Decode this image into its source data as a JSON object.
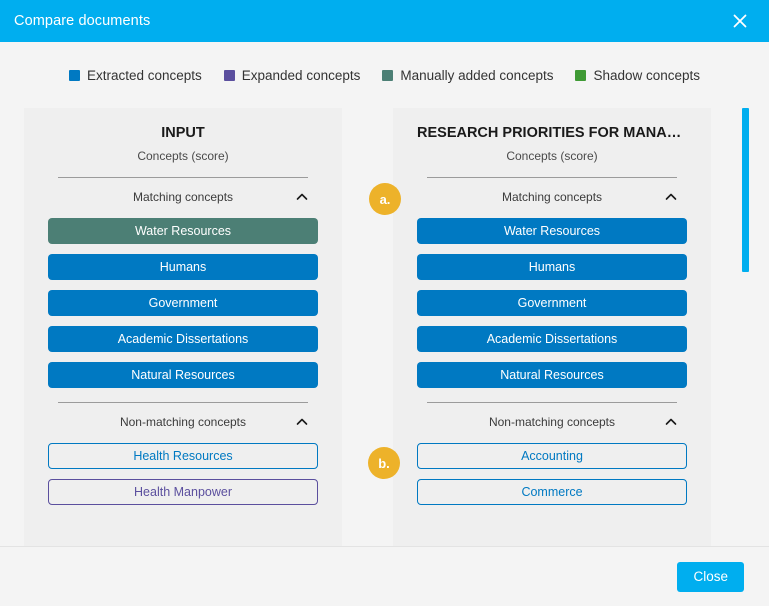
{
  "window": {
    "title": "Compare documents",
    "close_icon": "close-icon"
  },
  "legend": {
    "items": [
      {
        "label": "Extracted concepts",
        "color": "#0079C2"
      },
      {
        "label": "Expanded concepts",
        "color": "#5B4F9E"
      },
      {
        "label": "Manually added concepts",
        "color": "#4C7F75"
      },
      {
        "label": "Shadow concepts",
        "color": "#3F9A35"
      }
    ]
  },
  "panels": [
    {
      "title": "INPUT",
      "subtitle": "Concepts (score)",
      "sections": [
        {
          "header": "Matching concepts",
          "chevron": "chevron-up-icon",
          "chips": [
            {
              "label": "Water Resources",
              "style": "filled",
              "color": "#4C7F75"
            },
            {
              "label": "Humans",
              "style": "filled",
              "color": "#0079C2"
            },
            {
              "label": "Government",
              "style": "filled",
              "color": "#0079C2"
            },
            {
              "label": "Academic Dissertations",
              "style": "filled",
              "color": "#0079C2"
            },
            {
              "label": "Natural Resources",
              "style": "filled",
              "color": "#0079C2"
            }
          ]
        },
        {
          "header": "Non-matching concepts",
          "chevron": "chevron-up-icon",
          "chips": [
            {
              "label": "Health Resources",
              "style": "outline",
              "color": "#0079C2"
            },
            {
              "label": "Health Manpower",
              "style": "outline",
              "color": "#5B4F9E"
            }
          ]
        }
      ]
    },
    {
      "title": "RESEARCH PRIORITIES FOR MANAG…",
      "subtitle": "Concepts (score)",
      "sections": [
        {
          "header": "Matching concepts",
          "chevron": "chevron-up-icon",
          "chips": [
            {
              "label": "Water Resources",
              "style": "filled",
              "color": "#0079C2"
            },
            {
              "label": "Humans",
              "style": "filled",
              "color": "#0079C2"
            },
            {
              "label": "Government",
              "style": "filled",
              "color": "#0079C2"
            },
            {
              "label": "Academic Dissertations",
              "style": "filled",
              "color": "#0079C2"
            },
            {
              "label": "Natural Resources",
              "style": "filled",
              "color": "#0079C2"
            }
          ]
        },
        {
          "header": "Non-matching concepts",
          "chevron": "chevron-up-icon",
          "chips": [
            {
              "label": "Accounting",
              "style": "outline",
              "color": "#0079C2"
            },
            {
              "label": "Commerce",
              "style": "outline",
              "color": "#0079C2"
            }
          ]
        }
      ]
    }
  ],
  "markers": [
    {
      "label": "a.",
      "color": "#EDB22A"
    },
    {
      "label": "b.",
      "color": "#EDB22A"
    }
  ],
  "footer": {
    "close_label": "Close"
  },
  "theme": {
    "accent": "#00AEEF",
    "panel_bg": "#EFEFEF",
    "page_bg": "#F4F4F4"
  }
}
